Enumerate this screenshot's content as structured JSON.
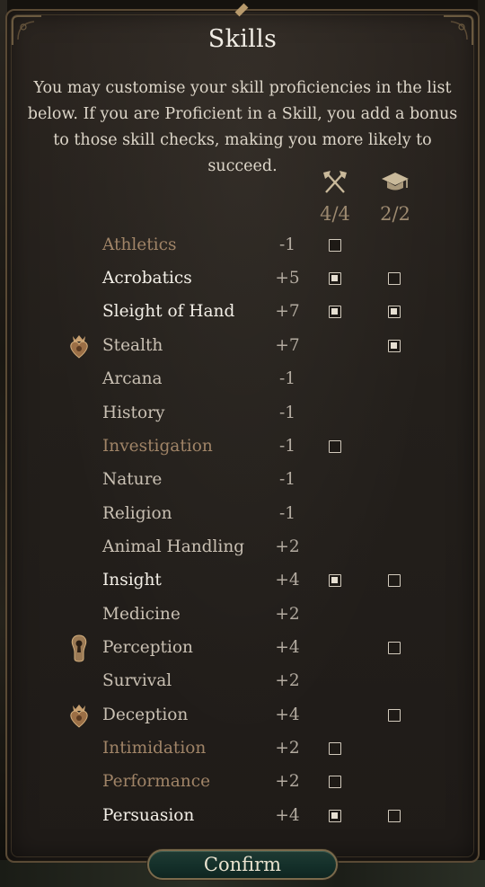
{
  "title": "Skills",
  "description": "You may customise your skill proficiencies in the list below. If you are Proficient in a Skill, you add a bonus to those skill checks, making you more likely to succeed.",
  "columns": [
    {
      "icon": "crossed-axes-icon",
      "count": "4/4"
    },
    {
      "icon": "graduation-cap-icon",
      "count": "2/2"
    }
  ],
  "skills": [
    {
      "name": "Athletics",
      "bonus": "-1",
      "style": "dim"
    },
    {
      "name": "Acrobatics",
      "bonus": "+5",
      "style": "bright"
    },
    {
      "name": "Sleight of Hand",
      "bonus": "+7",
      "style": "bright"
    },
    {
      "name": "Stealth",
      "bonus": "+7",
      "style": "normal",
      "badge": "heart-crown-icon"
    },
    {
      "name": "Arcana",
      "bonus": "-1",
      "style": "normal"
    },
    {
      "name": "History",
      "bonus": "-1",
      "style": "normal"
    },
    {
      "name": "Investigation",
      "bonus": "-1",
      "style": "dim"
    },
    {
      "name": "Nature",
      "bonus": "-1",
      "style": "normal"
    },
    {
      "name": "Religion",
      "bonus": "-1",
      "style": "normal"
    },
    {
      "name": "Animal Handling",
      "bonus": "+2",
      "style": "normal"
    },
    {
      "name": "Insight",
      "bonus": "+4",
      "style": "bright"
    },
    {
      "name": "Medicine",
      "bonus": "+2",
      "style": "normal"
    },
    {
      "name": "Perception",
      "bonus": "+4",
      "style": "normal",
      "badge": "keyhole-icon"
    },
    {
      "name": "Survival",
      "bonus": "+2",
      "style": "normal"
    },
    {
      "name": "Deception",
      "bonus": "+4",
      "style": "normal",
      "badge": "heart-crown-icon"
    },
    {
      "name": "Intimidation",
      "bonus": "+2",
      "style": "dim"
    },
    {
      "name": "Performance",
      "bonus": "+2",
      "style": "dim"
    },
    {
      "name": "Persuasion",
      "bonus": "+4",
      "style": "bright"
    }
  ],
  "checkboxes": {
    "class_column": [
      {
        "skill": "Athletics",
        "checked": false
      },
      {
        "skill": "Acrobatics",
        "checked": true
      },
      {
        "skill": "Sleight of Hand",
        "checked": true
      },
      {
        "skill": "Investigation",
        "checked": false
      },
      {
        "skill": "Insight",
        "checked": true
      },
      {
        "skill": "Intimidation",
        "checked": false
      },
      {
        "skill": "Performance",
        "checked": false
      },
      {
        "skill": "Persuasion",
        "checked": true
      }
    ],
    "background_column": [
      {
        "skill": "Acrobatics",
        "checked": false
      },
      {
        "skill": "Sleight of Hand",
        "checked": true
      },
      {
        "skill": "Stealth",
        "checked": true
      },
      {
        "skill": "Insight",
        "checked": false
      },
      {
        "skill": "Perception",
        "checked": false
      },
      {
        "skill": "Deception",
        "checked": false
      },
      {
        "skill": "Persuasion",
        "checked": false
      }
    ]
  },
  "confirm_label": "Confirm"
}
